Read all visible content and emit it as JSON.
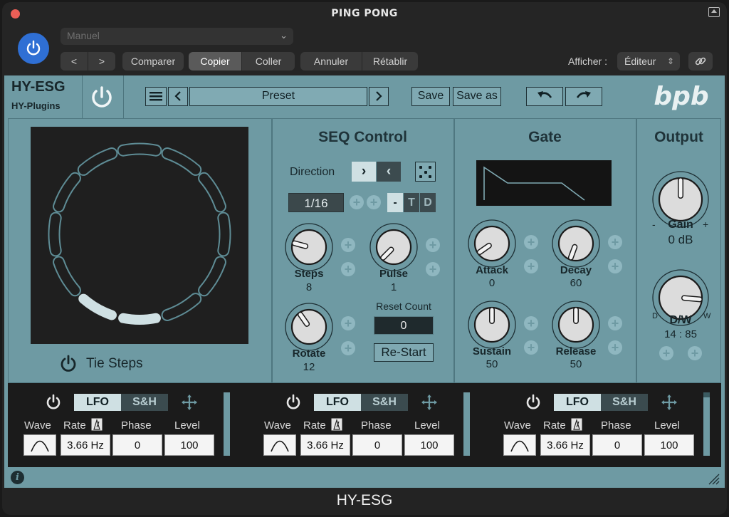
{
  "window": {
    "title": "PING PONG",
    "bottom_title": "HY-ESG"
  },
  "host": {
    "preset_placeholder": "Manuel",
    "buttons": {
      "prev": "<",
      "next": ">",
      "compare": "Comparer",
      "copy": "Copier",
      "paste": "Coller",
      "undo": "Annuler",
      "redo": "Rétablir"
    },
    "view_label": "Afficher :",
    "view_value": "Éditeur",
    "accent": "#2f6fd4"
  },
  "plugin": {
    "name": "HY-ESG",
    "vendor": "HY-Plugins",
    "logo": "bpb",
    "preset_label": "Preset",
    "save": "Save",
    "save_as": "Save as",
    "tie_steps": "Tie Steps",
    "seq": {
      "title": "SEQ Control",
      "direction_label": "Direction",
      "rate": "1/16",
      "mode_dash": "-",
      "mode_t": "T",
      "mode_d": "D",
      "steps_label": "Steps",
      "steps_value": "8",
      "pulse_label": "Pulse",
      "pulse_value": "1",
      "rotate_label": "Rotate",
      "rotate_value": "12",
      "reset_count_label": "Reset Count",
      "reset_count_value": "0",
      "restart": "Re-Start"
    },
    "gate": {
      "title": "Gate",
      "attack_label": "Attack",
      "attack_value": "0",
      "decay_label": "Decay",
      "decay_value": "60",
      "sustain_label": "Sustain",
      "sustain_value": "50",
      "release_label": "Release",
      "release_value": "50"
    },
    "output": {
      "title": "Output",
      "gain_label": "Gain",
      "gain_value": "0 dB",
      "gain_minus": "-",
      "gain_plus": "+",
      "dw_label": "D/W",
      "dw_value": "14 : 85",
      "dw_d": "D",
      "dw_w": "W"
    },
    "lfos": [
      {
        "tab_lfo": "LFO",
        "tab_sh": "S&H",
        "wave_label": "Wave",
        "rate_label": "Rate",
        "phase_label": "Phase",
        "level_label": "Level",
        "rate": "3.66 Hz",
        "phase": "0",
        "level": "100"
      },
      {
        "tab_lfo": "LFO",
        "tab_sh": "S&H",
        "wave_label": "Wave",
        "rate_label": "Rate",
        "phase_label": "Phase",
        "level_label": "Level",
        "rate": "3.66 Hz",
        "phase": "0",
        "level": "100"
      },
      {
        "tab_lfo": "LFO",
        "tab_sh": "S&H",
        "wave_label": "Wave",
        "rate_label": "Rate",
        "phase_label": "Phase",
        "level_label": "Level",
        "rate": "3.66 Hz",
        "phase": "0",
        "level": "100"
      }
    ],
    "info_glyph": "i",
    "colors": {
      "panel": "#6e9aa3",
      "dark": "#1b1b1b",
      "accent": "#7fa9b2"
    }
  }
}
